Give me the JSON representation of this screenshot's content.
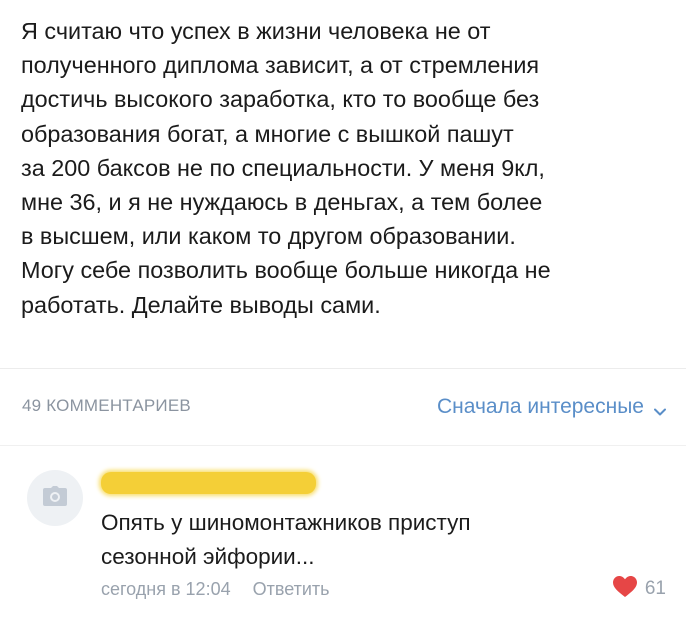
{
  "post": {
    "lines": [
      "Я считаю что успех в жизни человека не от",
      "полученного диплома зависит, а от стремления",
      "достичь высокого заработка, кто то вообще без",
      "образования богат, а многие с вышкой пашут",
      "за 200 баксов не по специальности. У меня 9кл,",
      "мне 36, и я не нуждаюсь в деньгах, а тем более",
      "в высшем, или каком то другом образовании.",
      "Могу себе позволить вообще больше никогда не",
      "работать. Делайте выводы сами."
    ]
  },
  "comments_header": {
    "count_label": "49 КОММЕНТАРИЕВ",
    "sort_label": "Сначала интересные"
  },
  "comment": {
    "author_name": "",
    "text_lines": [
      "Опять у шиномонтажников приступ",
      "сезонной эйфории..."
    ],
    "time": "сегодня в 12:04",
    "reply_label": "Ответить",
    "like_count": "61"
  },
  "icons": {
    "avatar_placeholder": "camera-icon",
    "sort_chevron": "chevron-down-icon",
    "like": "heart-icon"
  },
  "colors": {
    "accent": "#5a8ec8",
    "muted": "#99a2ad",
    "like": "#e64646",
    "name_redaction": "#f4cf37"
  }
}
